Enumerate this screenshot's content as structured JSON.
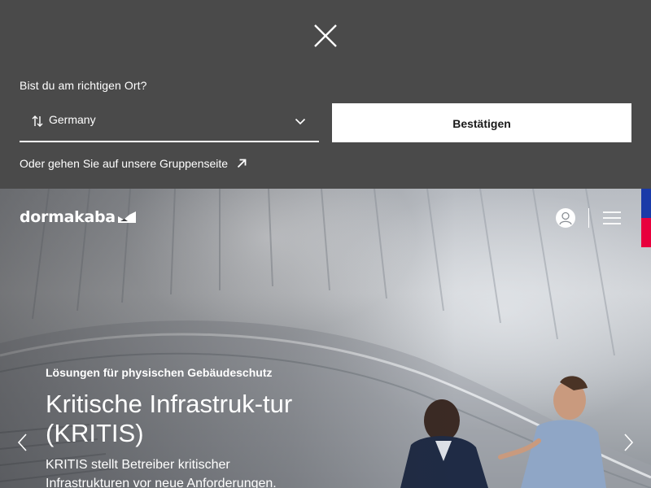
{
  "country_banner": {
    "prompt": "Bist du am richtigen Ort?",
    "selected_country": "Germany",
    "confirm_label": "Bestätigen",
    "group_link_label": "Oder gehen Sie auf unsere Gruppenseite"
  },
  "header": {
    "logo_text": "dormakaba"
  },
  "hero": {
    "eyebrow": "Lösungen für physischen Gebäudeschutz",
    "headline": "Kritische Infrastruk-tur (KRITIS)",
    "lead": "KRITIS stellt Betreiber kritischer Infrastrukturen vor neue Anforderungen."
  },
  "icons": {
    "close": "close-icon",
    "sort": "sort-icon",
    "chevron": "chevron-down-icon",
    "external": "external-link-icon",
    "user": "user-icon",
    "menu": "menu-icon",
    "prev": "chevron-left-icon",
    "next": "chevron-right-icon"
  },
  "colors": {
    "banner_bg": "#4a4a4a",
    "side_tab_blue": "#1a3aa8",
    "side_tab_red": "#e8003d"
  }
}
